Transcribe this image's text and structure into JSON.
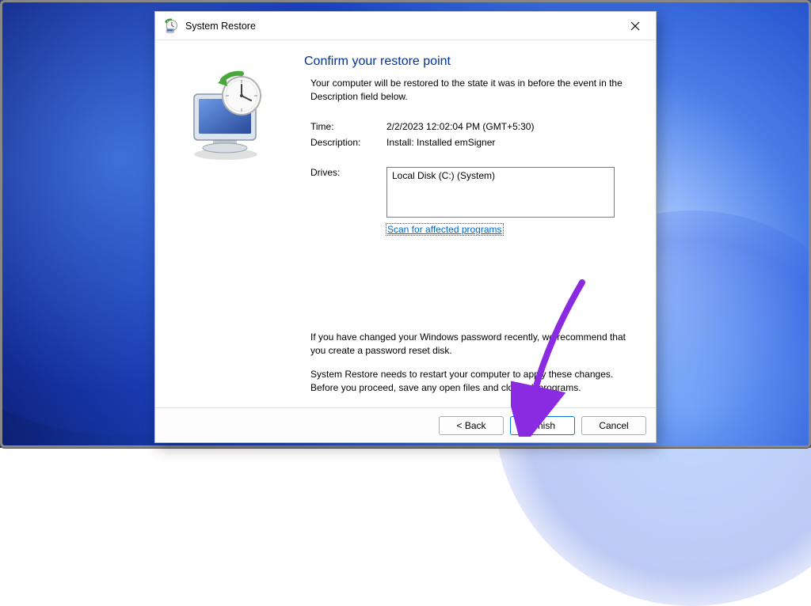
{
  "window": {
    "title": "System Restore"
  },
  "main": {
    "heading": "Confirm your restore point",
    "intro": "Your computer will be restored to the state it was in before the event in the Description field below.",
    "labels": {
      "time": "Time:",
      "description": "Description:",
      "drives": "Drives:"
    },
    "values": {
      "time": "2/2/2023 12:02:04 PM (GMT+5:30)",
      "description": "Install: Installed emSigner",
      "drive": "Local Disk (C:) (System)"
    },
    "scan_link": "Scan for affected programs",
    "note_password": "If you have changed your Windows password recently, we recommend that you create a password reset disk.",
    "note_restart": "System Restore needs to restart your computer to apply these changes. Before you proceed, save any open files and close all programs."
  },
  "footer": {
    "back": "< Back",
    "finish": "Finish",
    "cancel": "Cancel"
  }
}
